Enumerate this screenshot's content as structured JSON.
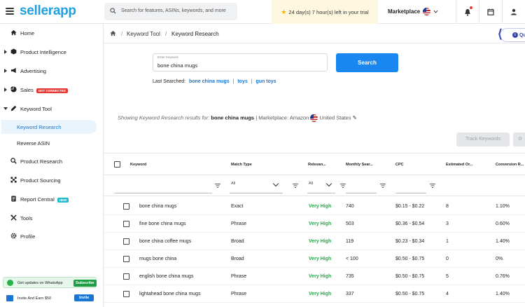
{
  "app": {
    "logo": "sellerapp"
  },
  "search": {
    "placeholder": "Search for features, ASINs, keywords, and more"
  },
  "trial": {
    "text": "24 day(s) 7 hour(s) left in your trial"
  },
  "marketplace": {
    "label": "Marketplace"
  },
  "sidebar": {
    "items": [
      {
        "label": "Home",
        "icon": "home-icon"
      },
      {
        "label": "Product Intelligence",
        "icon": "cube-icon"
      },
      {
        "label": "Advertising",
        "icon": "megaphone-icon"
      },
      {
        "label": "Sales",
        "icon": "pie-chart-icon",
        "badge": "NOT CONNECTED"
      },
      {
        "label": "Keyword Tool",
        "icon": "pen-icon"
      },
      {
        "label": "Keyword Research"
      },
      {
        "label": "Reverse ASIN"
      },
      {
        "label": "Product Research",
        "icon": "search-icon"
      },
      {
        "label": "Product Sourcing",
        "icon": "network-icon"
      },
      {
        "label": "Report Central",
        "icon": "report-icon",
        "badge": "NEW"
      },
      {
        "label": "Tools",
        "icon": "tools-icon"
      },
      {
        "label": "Profile",
        "icon": "gear-icon"
      }
    ],
    "whatsapp": {
      "text": "Get updates on WhatsApp",
      "button": "Subscribe"
    },
    "invite": {
      "text": "Invite And Earn $50",
      "button": "Invite"
    }
  },
  "breadcrumb": {
    "sep": "/",
    "crumb1": "Keyword Tool",
    "crumb2": "Keyword Research"
  },
  "quick_pill": {
    "text": "Qu"
  },
  "keyword_input": {
    "label": "Enter Keyword",
    "value": "bone china mugs"
  },
  "search_button": "Search",
  "last_searched": {
    "label": "Last Searched:",
    "items": [
      "bone china mugs",
      "toys",
      "gun toys"
    ]
  },
  "results": {
    "prefix": "Showing Keyword Research results for:",
    "keyword": "bone china mugs",
    "marketplace_text": "| Marketplace: Amazon",
    "country": "United States"
  },
  "track_button": "Track Keywords",
  "table": {
    "headers": [
      "Keyword",
      "Match Type",
      "Relevan...",
      "Monthly Sear...",
      "CPC",
      "Estimated Or...",
      "Conversion R..."
    ],
    "filters": {
      "match_type": "All",
      "relevance": "All"
    },
    "rows": [
      {
        "keyword": "bone china mugs",
        "match": "Exact",
        "relevance": "Very High",
        "monthly": "740",
        "cpc": "$0.15 - $0.22",
        "orders": "8",
        "conversion": "1.10%"
      },
      {
        "keyword": "fine bone china mugs",
        "match": "Phrase",
        "relevance": "Very High",
        "monthly": "503",
        "cpc": "$0.36 - $0.54",
        "orders": "3",
        "conversion": "0.60%"
      },
      {
        "keyword": "bone china coffee mugs",
        "match": "Broad",
        "relevance": "Very High",
        "monthly": "119",
        "cpc": "$0.23 - $0.34",
        "orders": "1",
        "conversion": "1.40%"
      },
      {
        "keyword": "mugs bone china",
        "match": "Broad",
        "relevance": "Very High",
        "monthly": "< 100",
        "cpc": "$0.50 - $0.75",
        "orders": "0",
        "conversion": "0%"
      },
      {
        "keyword": "english bone china mugs",
        "match": "Phrase",
        "relevance": "Very High",
        "monthly": "735",
        "cpc": "$0.50 - $0.75",
        "orders": "5",
        "conversion": "0.76%"
      },
      {
        "keyword": "lightahead bone china mugs",
        "match": "Phrase",
        "relevance": "Very High",
        "monthly": "337",
        "cpc": "$0.50 - $0.75",
        "orders": "4",
        "conversion": "1.40%"
      }
    ]
  },
  "colors": {
    "accent": "#1a87f0",
    "relevance": "#2ea44f",
    "brand": "#1fa0e0"
  }
}
